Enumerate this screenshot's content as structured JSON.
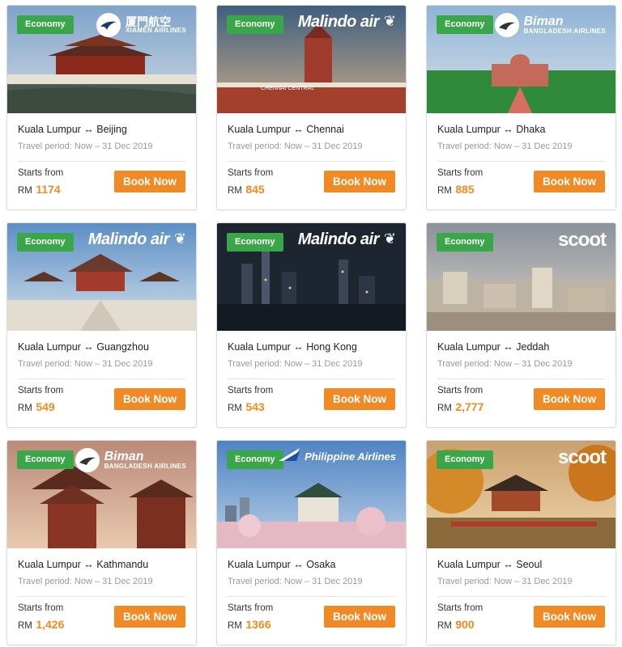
{
  "cards": [
    {
      "badge": "Economy",
      "airline": "XIAMEN AIRLINES",
      "airline_cn": "厦門航空",
      "route": "Kuala Lumpur ↔ Beijing",
      "period": "Travel period: Now – 31 Dec 2019",
      "starts": "Starts from",
      "currency": "RM",
      "price": "1174",
      "cta": "Book Now"
    },
    {
      "badge": "Economy",
      "airline": "Malindo air",
      "route": "Kuala Lumpur ↔ Chennai",
      "period": "Travel period: Now – 31 Dec 2019",
      "starts": "Starts from",
      "currency": "RM",
      "price": "845",
      "cta": "Book Now",
      "sign": "CHENNAI CENTRAL"
    },
    {
      "badge": "Economy",
      "airline": "Biman",
      "airline_sub": "BANGLADESH AIRLINES",
      "route": "Kuala Lumpur ↔ Dhaka",
      "period": "Travel period: Now – 31 Dec 2019",
      "starts": "Starts from",
      "currency": "RM",
      "price": "885",
      "cta": "Book Now"
    },
    {
      "badge": "Economy",
      "airline": "Malindo air",
      "route": "Kuala Lumpur ↔ Guangzhou",
      "period": "Travel period: Now – 31 Dec 2019",
      "starts": "Starts from",
      "currency": "RM",
      "price": "549",
      "cta": "Book Now"
    },
    {
      "badge": "Economy",
      "airline": "Malindo air",
      "route": "Kuala Lumpur ↔ Hong Kong",
      "period": "Travel period: Now – 31 Dec 2019",
      "starts": "Starts from",
      "currency": "RM",
      "price": "543",
      "cta": "Book Now"
    },
    {
      "badge": "Economy",
      "airline": "scoot",
      "route": "Kuala Lumpur ↔ Jeddah",
      "period": "Travel period: Now – 31 Dec 2019",
      "starts": "Starts from",
      "currency": "RM",
      "price": "2,777",
      "cta": "Book Now"
    },
    {
      "badge": "Economy",
      "airline": "Biman",
      "airline_sub": "BANGLADESH AIRLINES",
      "route": "Kuala Lumpur ↔ Kathmandu",
      "period": "Travel period: Now – 31 Dec 2019",
      "starts": "Starts from",
      "currency": "RM",
      "price": "1,426",
      "cta": "Book Now"
    },
    {
      "badge": "Economy",
      "airline": "Philippine Airlines",
      "route": "Kuala Lumpur ↔ Osaka",
      "period": "Travel period: Now – 31 Dec 2019",
      "starts": "Starts from",
      "currency": "RM",
      "price": "1366",
      "cta": "Book Now"
    },
    {
      "badge": "Economy",
      "airline": "scoot",
      "route": "Kuala Lumpur ↔ Seoul",
      "period": "Travel period: Now – 31 Dec 2019",
      "starts": "Starts from",
      "currency": "RM",
      "price": "900",
      "cta": "Book Now"
    }
  ],
  "colors": {
    "badge": "#3aa64a",
    "cta": "#f08a24",
    "price": "#f18b1f"
  }
}
